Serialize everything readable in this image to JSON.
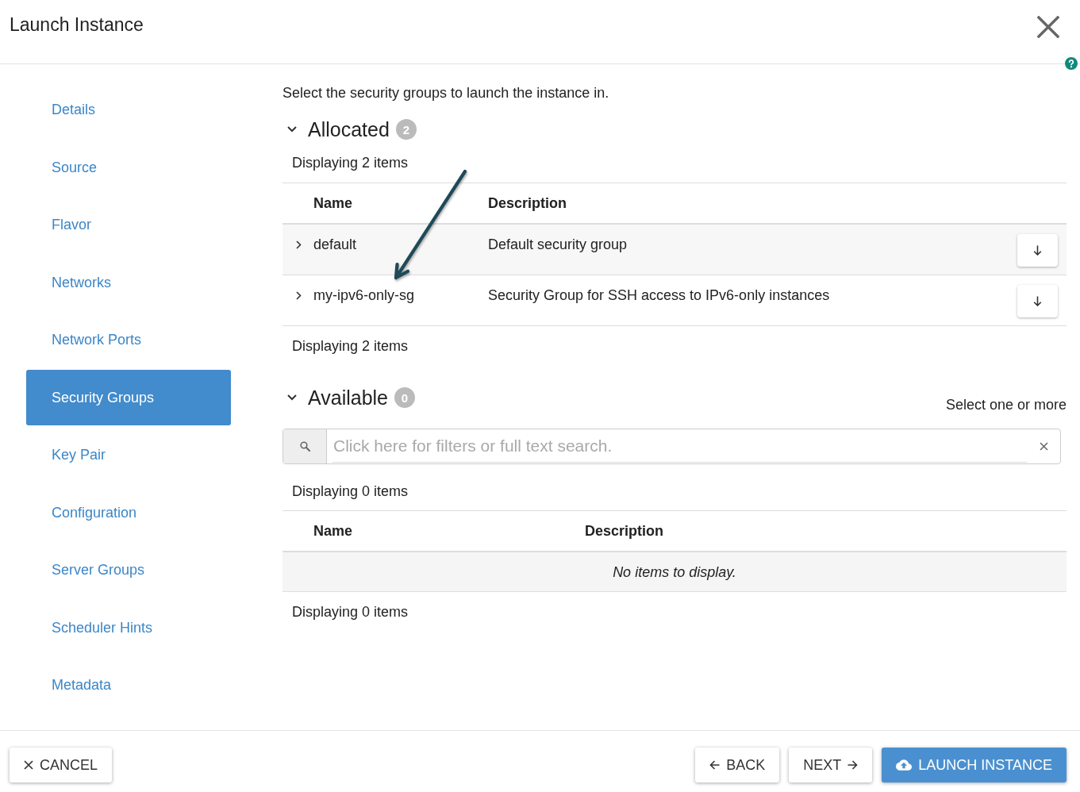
{
  "window": {
    "title": "Launch Instance"
  },
  "sidebar": {
    "items": [
      {
        "label": "Details",
        "selected": false
      },
      {
        "label": "Source",
        "selected": false
      },
      {
        "label": "Flavor",
        "selected": false
      },
      {
        "label": "Networks",
        "selected": false
      },
      {
        "label": "Network Ports",
        "selected": false
      },
      {
        "label": "Security Groups",
        "selected": true
      },
      {
        "label": "Key Pair",
        "selected": false
      },
      {
        "label": "Configuration",
        "selected": false
      },
      {
        "label": "Server Groups",
        "selected": false
      },
      {
        "label": "Scheduler Hints",
        "selected": false
      },
      {
        "label": "Metadata",
        "selected": false
      }
    ]
  },
  "main": {
    "intro": "Select the security groups to launch the instance in.",
    "sections": [
      {
        "kind": "allocated",
        "title": "Allocated",
        "count": "2",
        "expanded": true,
        "summary_top": "Displaying 2 items",
        "columns": [
          "Name",
          "Description"
        ],
        "rows": [
          {
            "name": "default",
            "description": "Default security group",
            "expanded": false
          },
          {
            "name": "my-ipv6-only-sg",
            "description": "Security Group for SSH access to IPv6-only instances",
            "expanded": false
          }
        ],
        "summary_bottom": "Displaying 2 items"
      },
      {
        "kind": "available",
        "title": "Available",
        "count": "0",
        "expanded": true,
        "hint": "Select one or more",
        "search": {
          "placeholder": "Click here for filters or full text search."
        },
        "summary_top": "Displaying 0 items",
        "columns": [
          "Name",
          "Description"
        ],
        "empty_message": "No items to display.",
        "summary_bottom": "Displaying 0 items"
      }
    ]
  },
  "footer": {
    "buttons": [
      {
        "label": "CANCEL",
        "kind": "cancel"
      },
      {
        "label": "BACK",
        "kind": "back"
      },
      {
        "label": "NEXT",
        "kind": "next"
      },
      {
        "label": "LAUNCH INSTANCE",
        "kind": "launch"
      }
    ]
  }
}
